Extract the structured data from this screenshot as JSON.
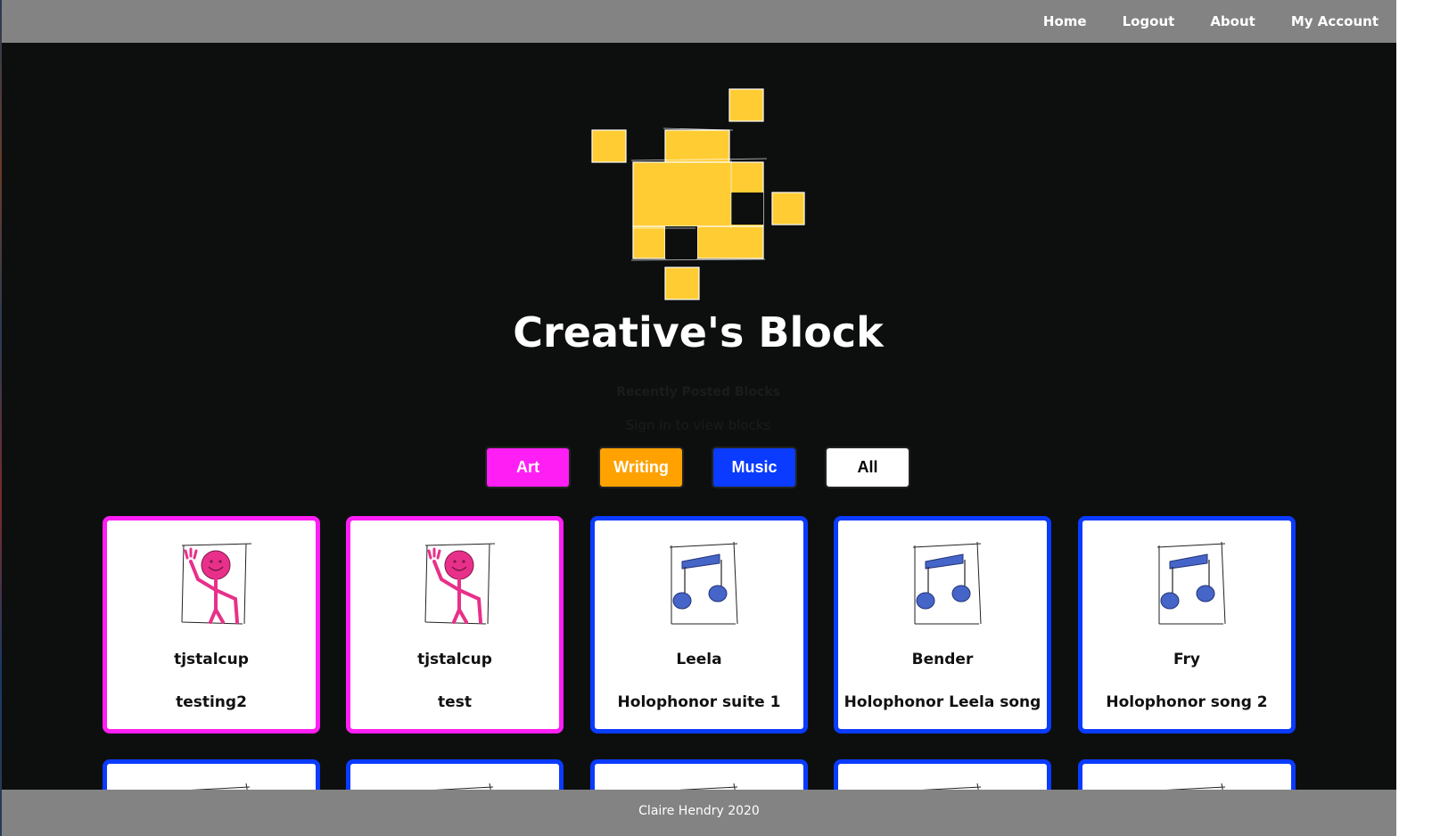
{
  "nav": {
    "home": "Home",
    "logout": "Logout",
    "about": "About",
    "account": "My Account"
  },
  "site": {
    "title": "Creative's Block",
    "recent_heading": "Recently Posted Blocks",
    "signin_message": "Sign in to view blocks"
  },
  "filters": {
    "art": "Art",
    "writing": "Writing",
    "music": "Music",
    "all": "All"
  },
  "colors": {
    "art": "#ff1ef3",
    "writing": "#ffa200",
    "music": "#0a3bff",
    "logo": "#ffcc33",
    "background": "#0d0f0f",
    "bars": "#838383"
  },
  "cards": [
    {
      "category": "art",
      "icon": "waving-figure-icon",
      "author": "tjstalcup",
      "title": "testing2"
    },
    {
      "category": "art",
      "icon": "waving-figure-icon",
      "author": "tjstalcup",
      "title": "test"
    },
    {
      "category": "music",
      "icon": "music-note-icon",
      "author": "Leela",
      "title": "Holophonor suite 1"
    },
    {
      "category": "music",
      "icon": "music-note-icon",
      "author": "Bender",
      "title": "Holophonor Leela song"
    },
    {
      "category": "music",
      "icon": "music-note-icon",
      "author": "Fry",
      "title": "Holophonor song 2"
    }
  ],
  "footer": {
    "credit": "Claire Hendry 2020"
  }
}
